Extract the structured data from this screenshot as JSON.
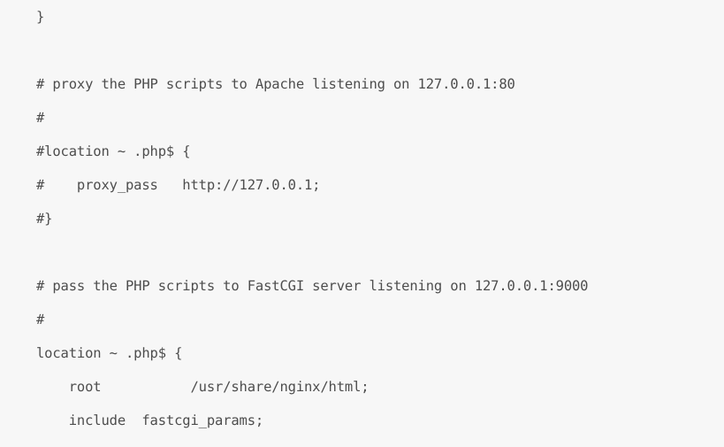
{
  "editor": {
    "language": "nginx",
    "background_color": "#f7f7f7",
    "text_color": "#4d4d4d",
    "lines": [
      {
        "id": "line-1",
        "text": "}"
      },
      {
        "id": "line-2",
        "text": ""
      },
      {
        "id": "line-3",
        "text": "# proxy the PHP scripts to Apache listening on 127.0.0.1:80"
      },
      {
        "id": "line-4",
        "text": "#"
      },
      {
        "id": "line-5",
        "text": "#location ~ .php$ {"
      },
      {
        "id": "line-6",
        "text": "#    proxy_pass   http://127.0.0.1;"
      },
      {
        "id": "line-7",
        "text": "#}"
      },
      {
        "id": "line-8",
        "text": ""
      },
      {
        "id": "line-9",
        "text": "# pass the PHP scripts to FastCGI server listening on 127.0.0.1:9000"
      },
      {
        "id": "line-10",
        "text": "#"
      },
      {
        "id": "line-11",
        "text": "location ~ .php$ {"
      },
      {
        "id": "line-12",
        "text": "    root           /usr/share/nginx/html;"
      },
      {
        "id": "line-13",
        "text": "    include  fastcgi_params;"
      }
    ]
  }
}
